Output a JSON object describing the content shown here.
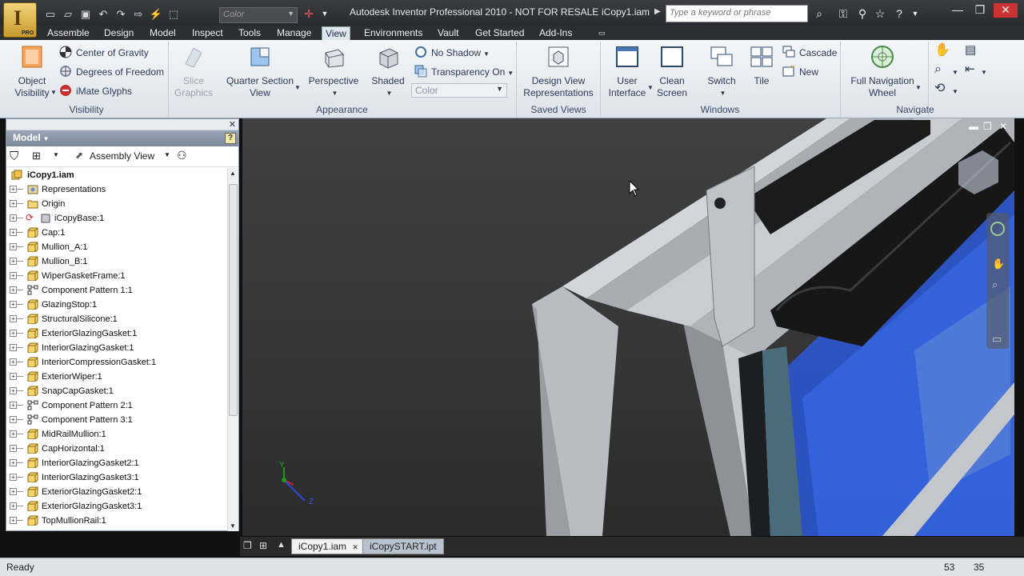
{
  "app": {
    "logo_letter": "I",
    "edition_badge": "PRO",
    "title": "Autodesk Inventor Professional 2010 - NOT FOR RESALE",
    "document_title": "iCopy1.iam",
    "color_combo_placeholder": "Color",
    "search_placeholder": "Type a keyword or phrase"
  },
  "tabs": [
    "Assemble",
    "Design",
    "Model",
    "Inspect",
    "Tools",
    "Manage",
    "View",
    "Environments",
    "Vault",
    "Get Started",
    "Add-Ins"
  ],
  "active_tab": "View",
  "ribbon": {
    "visibility": {
      "panel_label": "Visibility",
      "object_visibility": "Object Visibility",
      "object_visibility_l1": "Object",
      "object_visibility_l2": "Visibility",
      "center_of_gravity": "Center of Gravity",
      "degrees_of_freedom": "Degrees of Freedom",
      "imate_glyphs": "iMate Glyphs"
    },
    "appearance": {
      "panel_label": "Appearance",
      "slice_l1": "Slice",
      "slice_l2": "Graphics",
      "quarter_l1": "Quarter Section",
      "quarter_l2": "View",
      "perspective": "Perspective",
      "shaded": "Shaded",
      "no_shadow": "No Shadow",
      "transparency_on": "Transparency On",
      "color_style": "Color"
    },
    "saved_views": {
      "panel_label": "Saved Views",
      "design_l1": "Design View",
      "design_l2": "Representations"
    },
    "windows": {
      "panel_label": "Windows",
      "ui_l1": "User",
      "ui_l2": "Interface",
      "clean_l1": "Clean",
      "clean_l2": "Screen",
      "switch": "Switch",
      "tile": "Tile",
      "cascade": "Cascade",
      "new": "New"
    },
    "navigate": {
      "panel_label": "Navigate",
      "wheel_l1": "Full Navigation",
      "wheel_l2": "Wheel"
    }
  },
  "browser": {
    "header": "Model",
    "view_label": "Assembly View",
    "root": "iCopy1.iam",
    "items": [
      {
        "label": "Representations",
        "icon": "representations-icon"
      },
      {
        "label": "Origin",
        "icon": "folder-icon"
      },
      {
        "label": "iCopyBase:1",
        "icon": "grounded-part-icon"
      },
      {
        "label": "Cap:1",
        "icon": "part-icon"
      },
      {
        "label": "Mullion_A:1",
        "icon": "part-icon"
      },
      {
        "label": "Mullion_B:1",
        "icon": "part-icon"
      },
      {
        "label": "WiperGasketFrame:1",
        "icon": "part-icon"
      },
      {
        "label": "Component Pattern 1:1",
        "icon": "pattern-icon"
      },
      {
        "label": "GlazingStop:1",
        "icon": "part-icon"
      },
      {
        "label": "StructuralSilicone:1",
        "icon": "part-icon"
      },
      {
        "label": "ExteriorGlazingGasket:1",
        "icon": "part-icon"
      },
      {
        "label": "InteriorGlazingGasket:1",
        "icon": "part-icon"
      },
      {
        "label": "InteriorCompressionGasket:1",
        "icon": "part-icon"
      },
      {
        "label": "ExteriorWiper:1",
        "icon": "part-icon"
      },
      {
        "label": "SnapCapGasket:1",
        "icon": "part-icon"
      },
      {
        "label": "Component Pattern 2:1",
        "icon": "pattern-icon"
      },
      {
        "label": "Component Pattern 3:1",
        "icon": "pattern-icon"
      },
      {
        "label": "MidRailMullion:1",
        "icon": "part-icon"
      },
      {
        "label": "CapHorizontal:1",
        "icon": "part-icon"
      },
      {
        "label": "InteriorGlazingGasket2:1",
        "icon": "part-icon"
      },
      {
        "label": "InteriorGlazingGasket3:1",
        "icon": "part-icon"
      },
      {
        "label": "ExteriorGlazingGasket2:1",
        "icon": "part-icon"
      },
      {
        "label": "ExteriorGlazingGasket3:1",
        "icon": "part-icon"
      },
      {
        "label": "TopMullionRail:1",
        "icon": "part-icon"
      }
    ]
  },
  "viewport": {
    "triad_y": "Y",
    "triad_z": "Z"
  },
  "doc_tabs": [
    {
      "label": "iCopy1.iam",
      "active": true
    },
    {
      "label": "iCopySTART.ipt",
      "active": false
    }
  ],
  "status": {
    "text": "Ready",
    "value1": "53",
    "value2": "35"
  },
  "colors": {
    "ribbon_bg": "#e6ebf0",
    "viewport_bg": "#3a3a3a",
    "glass_blue": "#2a58d8",
    "active_tab_bg": "#dfe6ee"
  }
}
